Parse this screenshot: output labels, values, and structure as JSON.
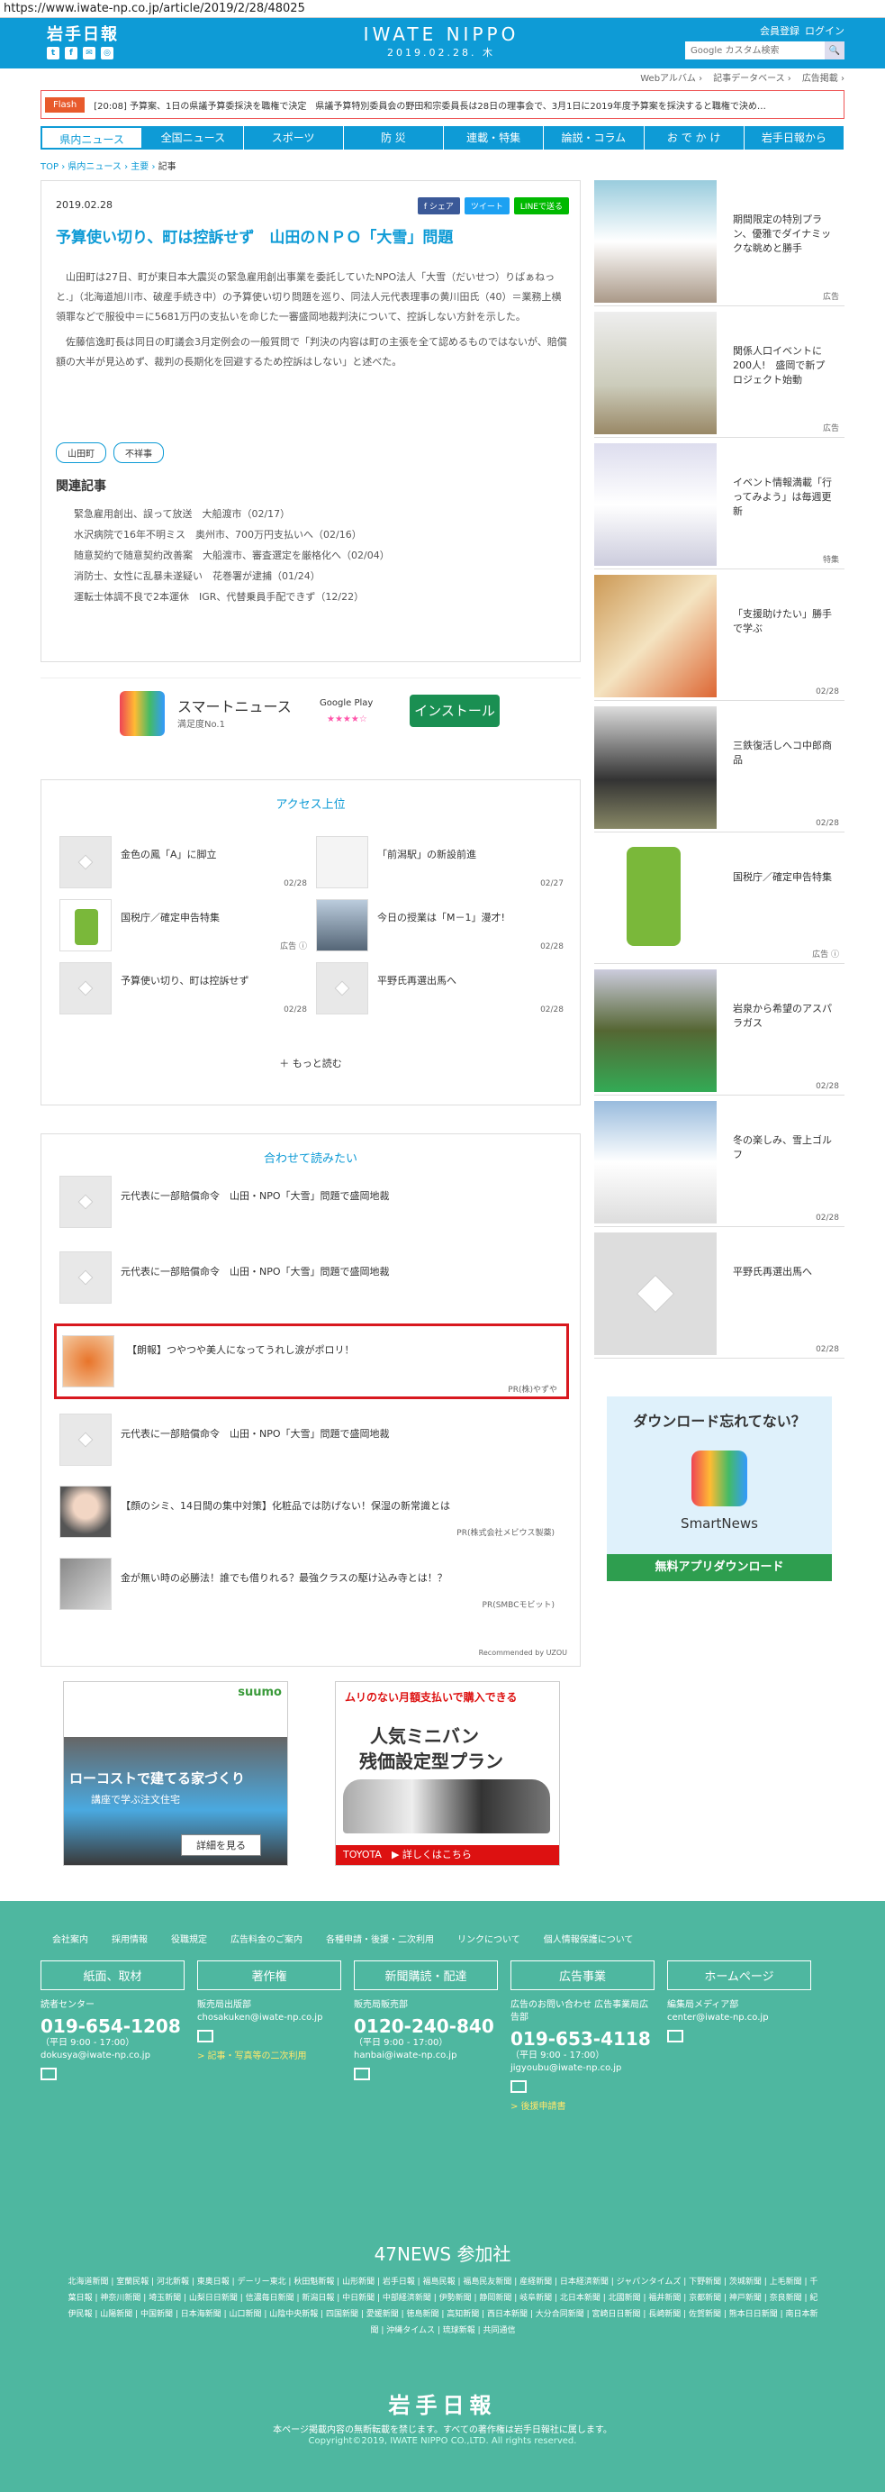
{
  "url": "https://www.iwate-np.co.jp/article/2019/2/28/48025",
  "header": {
    "logo": "岩手日報",
    "brand": "IWATE NIPPO",
    "date": "2019.02.28. 木",
    "member": "会員登録",
    "login": "ログイン",
    "search_placeholder": "Google カスタム検索",
    "social": [
      "t",
      "f",
      "✉",
      "◎"
    ]
  },
  "subnav": [
    "Webアルバム ›",
    "記事データベース ›",
    "広告掲載 ›"
  ],
  "flash": {
    "tag": "Flash",
    "text": "[20:08] 予算案、1日の県議予算委採決を職権で決定　県議予算特別委員会の野田和宗委員長は28日の理事会で、3月1日に2019年度予算案を採決すると職権で決め…"
  },
  "nav": [
    "県内ニュース",
    "全国ニュース",
    "スポーツ",
    "防 災",
    "連載・特集",
    "論説・コラム",
    "お で か け",
    "岩手日報から"
  ],
  "breadcrumb": {
    "top": "TOP",
    "sep1": "›",
    "cat": "県内ニュース",
    "sep2": "›",
    "sub": "主要",
    "sep3": "›",
    "cur": "記事"
  },
  "article": {
    "date": "2019.02.28",
    "share": [
      "f シェア",
      "ツイート",
      "LINEで送る"
    ],
    "title": "予算使い切り、町は控訴せず　山田のＮＰＯ「大雪」問題",
    "body": [
      "山田町は27日、町が東日本大震災の緊急雇用創出事業を委託していたNPO法人「大雪（だいせつ）りばぁねっと.」（北海道旭川市、破産手続き中）の予算使い切り問題を巡り、同法人元代表理事の黄川田氏（40）＝業務上横領罪などで服役中＝に5681万円の支払いを命じた一審盛岡地裁判決について、控訴しない方針を示した。",
      "佐藤信逸町長は同日の町議会3月定例会の一般質問で「判決の内容は町の主張を全て認めるものではないが、賠償額の大半が見込めず、裁判の長期化を回避するため控訴はしない」と述べた。"
    ],
    "tags": [
      "山田町",
      "不祥事"
    ],
    "related_head": "関連記事",
    "related": [
      "緊急雇用創出、誤って放送　大船渡市（02/17）",
      "水沢病院で16年不明ミス　奥州市、700万円支払いへ（02/16）",
      "随意契約で随意契約改善案　大船渡市、審査選定を厳格化へ（02/04）",
      "消防士、女性に乱暴未遂疑い　花巻署が逮捕（01/24）",
      "運転士体調不良で2本運休　IGR、代替乗員手配できず（12/22）"
    ]
  },
  "ad_smartnews": {
    "title": "スマートニュース",
    "sub": "満足度No.1",
    "store": "Google Play",
    "stars": "★★★★☆",
    "button": "インストール"
  },
  "ranking": {
    "head": "アクセス上位",
    "items": [
      {
        "title": "金色の鳳「A」に脚立",
        "date": "02/28"
      },
      {
        "title": "「前潟駅」の新設前進",
        "date": "02/27"
      },
      {
        "title": "国税庁／確定申告特集",
        "date": "広告 ⓘ"
      },
      {
        "title": "今日の授業は「M－1」漫才!",
        "date": "02/28"
      },
      {
        "title": "予算使い切り、町は控訴せず",
        "date": "02/28"
      },
      {
        "title": "平野氏再選出馬へ",
        "date": "02/28"
      }
    ],
    "more": "＋ もっと読む"
  },
  "recs": {
    "head": "合わせて読みたい",
    "items": [
      {
        "title": "元代表に一部賠償命令　山田・NPO「大雪」問題で盛岡地裁",
        "src": ""
      },
      {
        "title": "元代表に一部賠償命令　山田・NPO「大雪」問題で盛岡地裁",
        "src": ""
      },
      {
        "title": "【朗報】つやつや美人になってうれし涙がポロリ！",
        "src": "PR(株)やずや"
      },
      {
        "title": "元代表に一部賠償命令　山田・NPO「大雪」問題で盛岡地裁",
        "src": ""
      },
      {
        "title": "【顔のシミ、14日間の集中対策】化粧品では防げない！保湿の新常識とは",
        "src": "PR(株式会社メビウス製薬)"
      },
      {
        "title": "金が無い時の必勝法！誰でも借りれる？最強クラスの駆け込み寺とは！？",
        "src": "PR(SMBCモビット)"
      }
    ],
    "powered": "Recommended by UZOU"
  },
  "ad_suumo": {
    "brand": "suumo",
    "caption": "ローコストで建てる家づくり",
    "sub": "講座で学ぶ注文住宅",
    "button": "詳細を見る"
  },
  "ad_toyota": {
    "l1": "ムリのない月額支払いで購入できる",
    "l2": "人気ミニバン",
    "l3": "残価設定型プラン",
    "footer": "TOYOTA　▶ 詳しくはこちら"
  },
  "sidebar": [
    {
      "title": "期間限定の特別プラン、優雅でダイナミックな眺めと勝手",
      "date": "広告"
    },
    {
      "title": "関係人口イベントに200人!　盛岡で新プロジェクト始動",
      "date": "広告"
    },
    {
      "title": "イベント情報満載「行ってみよう」は毎週更新",
      "date": "特集"
    },
    {
      "title": "「支援助けたい」勝手で学ぶ",
      "date": "02/28"
    },
    {
      "title": "三鉄復活しへコ中郎商品",
      "date": "02/28"
    },
    {
      "title": "国税庁／確定申告特集",
      "date": "広告 ⓘ"
    },
    {
      "title": "岩泉から希望のアスパラガス",
      "date": "02/28"
    },
    {
      "title": "冬の楽しみ、雪上ゴルフ",
      "date": "02/28"
    },
    {
      "title": "平野氏再選出馬へ",
      "date": "02/28"
    }
  ],
  "sn_ad": {
    "head": "ダウンロード忘れてない？",
    "name": "SmartNews",
    "button": "無料アプリダウンロード"
  },
  "footer": {
    "links": [
      "会社案内",
      "採用情報",
      "役職規定",
      "広告料金のご案内",
      "各種申請・後援・二次利用",
      "リンクについて",
      "個人情報保護について"
    ],
    "cols": [
      {
        "head": "紙面、取材",
        "l1": "読者センター",
        "tel": "019-654-1208",
        "l2": "（平日 9:00 - 17:00）",
        "mail": "dokusya@iwate-np.co.jp"
      },
      {
        "head": "著作権",
        "l1": "販売局出版部",
        "tel": "",
        "l2": "",
        "mail": "chosakuken@iwate-np.co.jp",
        "yl": "> 記事・写真等の二次利用"
      },
      {
        "head": "新聞購読・配達",
        "l1": "販売局販売部",
        "tel": "0120-240-840",
        "l2": "（平日 9:00 - 17:00）",
        "mail": "hanbai@iwate-np.co.jp"
      },
      {
        "head": "広告事業",
        "l1": "広告のお問い合わせ 広告事業局広告部",
        "tel": "019-653-4118",
        "l2": "（平日 9:00 - 17:00）",
        "mail": "jigyoubu@iwate-np.co.jp",
        "yl": "> 後援申請書"
      },
      {
        "head": "ホームページ",
        "l1": "編集局メディア部",
        "tel": "",
        "l2": "",
        "mail": "center@iwate-np.co.jp"
      }
    ],
    "n47": "47NEWS 参加社",
    "n47list": "北海道新聞 | 室蘭民報 | 河北新報 | 東奥日報 | デーリー東北 | 秋田魁新報 | 山形新聞 | 岩手日報 | 福島民報 | 福島民友新聞 | 産経新聞 | 日本経済新聞 | ジャパンタイムズ | 下野新聞 | 茨城新聞 | 上毛新聞 | 千葉日報 | 神奈川新聞 | 埼玉新聞 | 山梨日日新聞 | 信濃毎日新聞 | 新潟日報 | 中日新聞 | 中部経済新聞 | 伊勢新聞 | 静岡新聞 | 岐阜新聞 | 北日本新聞 | 北國新聞 | 福井新聞 | 京都新聞 | 神戸新聞 | 奈良新聞 | 紀伊民報 | 山陽新聞 | 中国新聞 | 日本海新聞 | 山口新聞 | 山陰中央新報 | 四国新聞 | 愛媛新聞 | 徳島新聞 | 高知新聞 | 西日本新聞 | 大分合同新聞 | 宮崎日日新聞 | 長崎新聞 | 佐賀新聞 | 熊本日日新聞 | 南日本新聞 | 沖縄タイムス | 琉球新報 | 共同通信",
    "logo": "岩手日報",
    "note": "本ページ掲載内容の無断転載を禁じます。すべての著作権は岩手日報社に属します。",
    "copy": "Copyright©2019, IWATE NIPPO CO.,LTD. All rights reserved."
  }
}
